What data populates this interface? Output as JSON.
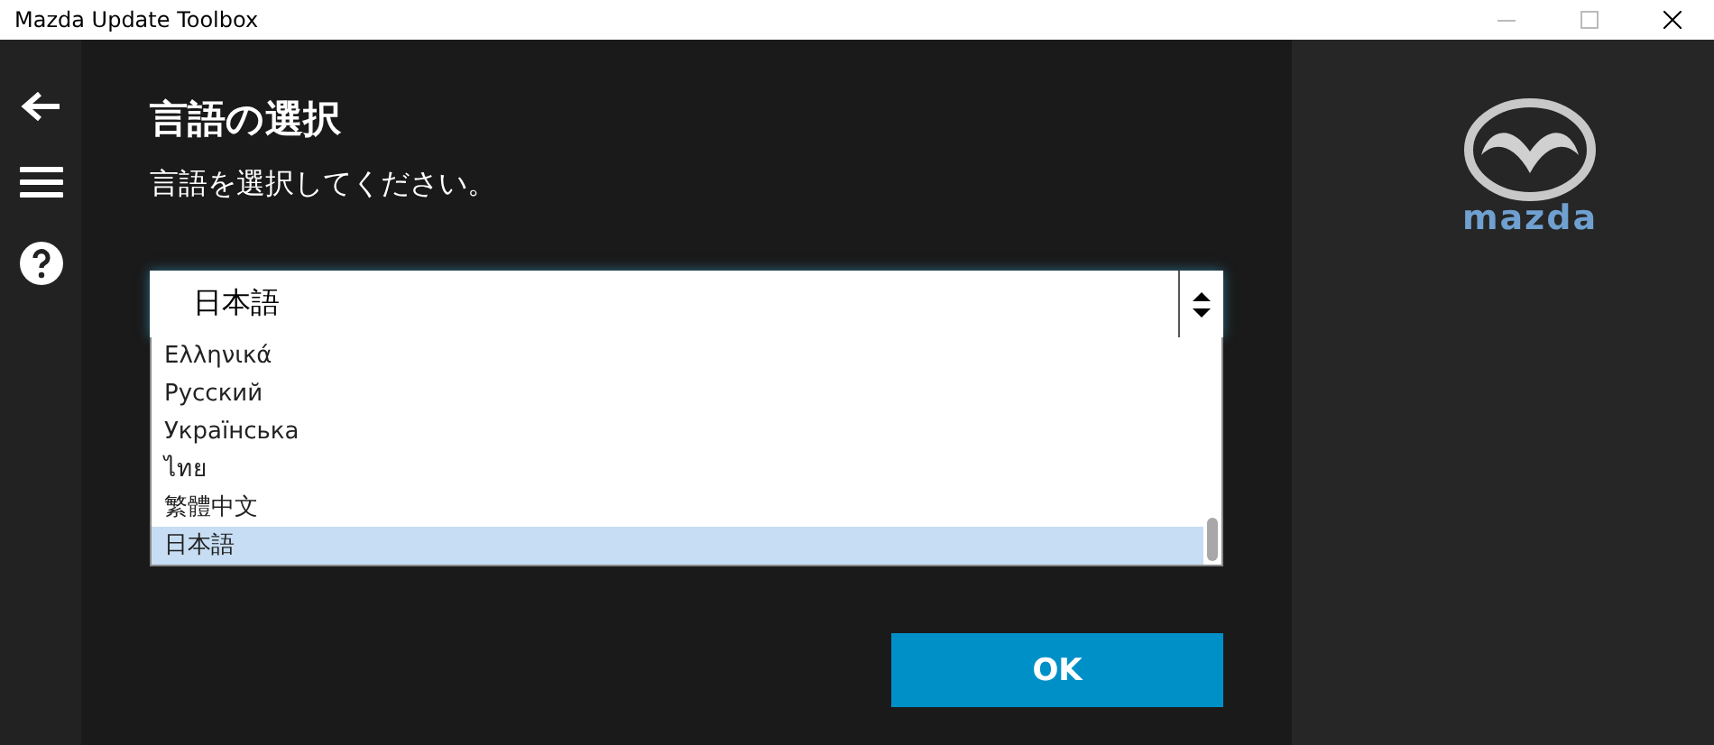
{
  "window": {
    "title": "Mazda Update Toolbox"
  },
  "sidebar": {
    "items": [
      {
        "kind": "back"
      },
      {
        "kind": "menu"
      },
      {
        "kind": "help"
      }
    ]
  },
  "heading": "言語の選択",
  "instruction": "言語を選択してください。",
  "language_select": {
    "value": "日本語",
    "options": [
      {
        "label": "Ελληνικά",
        "selected": false
      },
      {
        "label": "Русский",
        "selected": false
      },
      {
        "label": "Українська",
        "selected": false
      },
      {
        "label": "ไทย",
        "selected": false
      },
      {
        "label": "繁體中文",
        "selected": false
      },
      {
        "label": "日本語",
        "selected": true
      }
    ]
  },
  "ok_button": "OK",
  "logo": {
    "wordmark": "mazda"
  }
}
